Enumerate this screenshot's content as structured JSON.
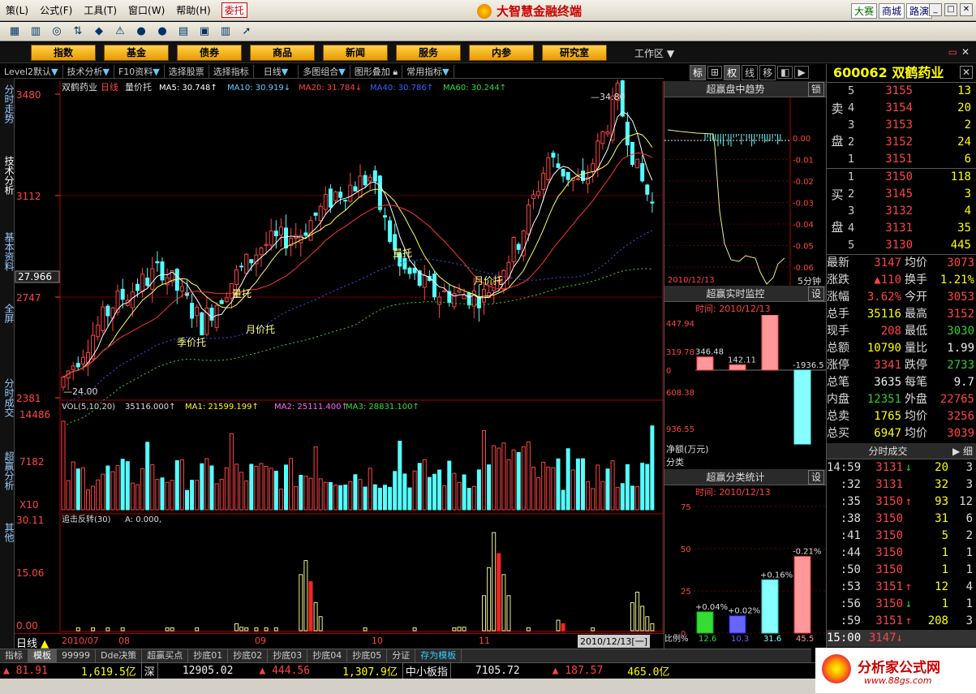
{
  "menu": [
    "策(L)",
    "公式(F)",
    "工具(T)",
    "窗口(W)",
    "帮助(H)"
  ],
  "menu_highlight": "委托",
  "app_title": "大智慧金融终端",
  "top_links": [
    "大赛",
    "商城",
    "路演"
  ],
  "nav_buttons": [
    "指数",
    "基金",
    "债券",
    "商品",
    "新闻",
    "服务",
    "内参",
    "研究室"
  ],
  "work_area": "工作区",
  "chart_toolbar": [
    "Level2默认",
    "技术分析",
    "F10资料",
    "选择股票",
    "选择指标",
    "日线",
    "多图组合",
    "图形叠加",
    "常用指标"
  ],
  "right_tabs": [
    "标",
    "权",
    "线",
    "移"
  ],
  "left_tabs": [
    "分时走势",
    "技术分析",
    "基本资料",
    "全屏",
    "分时成交",
    "超赢分析",
    "其他"
  ],
  "chart_header": {
    "name": "双鹤药业",
    "period": "日线",
    "indicator": "量价托",
    "ma5": "MA5: 30.748↑",
    "ma10": "MA10: 30.919↓",
    "ma20": "MA20: 31.784↓",
    "ma40": "MA40: 30.786↑",
    "ma60": "MA60: 30.244↑"
  },
  "vol_header": {
    "label": "VOL(5,10,20)",
    "vol": "35116.000↑",
    "ma1": "MA1: 21599.199↑",
    "ma2": "MA2: 25111.400↑",
    "ma3": "MA3: 28831.100↑"
  },
  "ind_header": {
    "label": "追击反转(30)",
    "a": "A: 0.000,"
  },
  "chart_data": {
    "type": "candlestick",
    "price_axis": {
      "ticks": [
        "3480",
        "3112",
        "2747",
        "2381"
      ],
      "range": [
        23.81,
        34.8
      ]
    },
    "cursor_value": "27.966",
    "high_label": "34.80",
    "low_label": "24.00",
    "vol_axis": {
      "ticks": [
        "14486",
        "7182",
        "X10"
      ],
      "range": [
        0,
        14486
      ]
    },
    "ind_axis": {
      "ticks": [
        "30.11",
        "15.06",
        "0.00"
      ],
      "range": [
        0,
        30.11
      ]
    },
    "date_axis": [
      "2010/07",
      "08",
      "09",
      "10",
      "11"
    ],
    "cursor_date": "2010/12/13[一]",
    "annotations": [
      "季价托",
      "量托",
      "月价托",
      "量托",
      "月价托",
      "月价托"
    ],
    "period_label": "日线"
  },
  "panel_trend": {
    "title": "超赢盘中趋势",
    "lock": "锁",
    "axis": [
      "0.00",
      "-0.01",
      "-0.02",
      "-0.03",
      "-0.04",
      "-0.05",
      "-0.06",
      "-0.07"
    ],
    "date": "2010/12/13",
    "period": "5分钟"
  },
  "panel_monitor": {
    "title": "超赢实时监控",
    "btn": "设",
    "time": "时间: 2010/12/13",
    "axis": [
      "447.94",
      "319.78",
      "0",
      "608.38",
      "936.55"
    ],
    "bars": [
      {
        "label": "散户",
        "value": "346.48",
        "v": 346.48
      },
      {
        "label": "中户",
        "value": "142.11",
        "v": 142.11
      },
      {
        "label": "大户",
        "value": "1447.94",
        "v": 1447.94
      },
      {
        "label": "超大",
        "value": "-1936.5",
        "v": -1936.5
      }
    ],
    "unit": "净额(万元)",
    "cat": "分类"
  },
  "panel_class": {
    "title": "超赢分类统计",
    "btn": "设",
    "time": "时间: 2010/12/13",
    "axis": [
      "75",
      "50",
      "25",
      "0"
    ],
    "bars": [
      {
        "label": "散户",
        "pct": "+0.04%",
        "value": "12.6",
        "v": 12.6
      },
      {
        "label": "中户",
        "pct": "+0.02%",
        "value": "10.3",
        "v": 10.3
      },
      {
        "label": "大户",
        "pct": "+0.16%",
        "value": "31.6",
        "v": 31.6
      },
      {
        "label": "超大",
        "pct": "-0.21%",
        "value": "45.5",
        "v": 45.5
      }
    ],
    "ratio": "比例%",
    "cat": "分类"
  },
  "quote": {
    "code": "600062",
    "name": "双鹤药业",
    "sell_label": [
      "卖",
      "盘"
    ],
    "buy_label": [
      "买",
      "盘"
    ],
    "asks": [
      {
        "lv": "5",
        "px": "3155",
        "vol": "13"
      },
      {
        "lv": "4",
        "px": "3154",
        "vol": "20"
      },
      {
        "lv": "3",
        "px": "3153",
        "vol": "2"
      },
      {
        "lv": "2",
        "px": "3152",
        "vol": "24"
      },
      {
        "lv": "1",
        "px": "3151",
        "vol": "6"
      }
    ],
    "bids": [
      {
        "lv": "1",
        "px": "3150",
        "vol": "118"
      },
      {
        "lv": "2",
        "px": "3145",
        "vol": "3"
      },
      {
        "lv": "3",
        "px": "3132",
        "vol": "4"
      },
      {
        "lv": "4",
        "px": "3131",
        "vol": "35"
      },
      {
        "lv": "5",
        "px": "3130",
        "vol": "445"
      }
    ],
    "stats": [
      {
        "l": "最新",
        "v": "3147",
        "c": "red",
        "l2": "均价",
        "v2": "3073",
        "c2": "red"
      },
      {
        "l": "涨跌",
        "v": "▲110",
        "c": "red",
        "l2": "换手",
        "v2": "1.21%",
        "c2": "yel"
      },
      {
        "l": "涨幅",
        "v": "3.62%",
        "c": "red",
        "l2": "今开",
        "v2": "3053",
        "c2": "red"
      },
      {
        "l": "总手",
        "v": "35116",
        "c": "yel",
        "l2": "最高",
        "v2": "3152",
        "c2": "red"
      },
      {
        "l": "现手",
        "v": "208",
        "c": "red",
        "l2": "最低",
        "v2": "3030",
        "c2": "grn"
      },
      {
        "l": "总额",
        "v": "10790",
        "c": "yel",
        "l2": "量比",
        "v2": "1.99",
        "c2": "wht"
      },
      {
        "l": "涨停",
        "v": "3341",
        "c": "red",
        "l2": "跌停",
        "v2": "2733",
        "c2": "grn"
      },
      {
        "l": "总笔",
        "v": "3635",
        "c": "wht",
        "l2": "每笔",
        "v2": "9.7",
        "c2": "wht"
      },
      {
        "l": "内盘",
        "v": "12351",
        "c": "grn",
        "l2": "外盘",
        "v2": "22765",
        "c2": "red"
      },
      {
        "l": "总卖",
        "v": "1765",
        "c": "yel",
        "l2": "均价",
        "v2": "3256",
        "c2": "red"
      },
      {
        "l": "总买",
        "v": "6947",
        "c": "yel",
        "l2": "均价",
        "v2": "3039",
        "c2": "red"
      }
    ],
    "ticks_title": "分时成交",
    "ticks_btn": "细",
    "ticks": [
      {
        "t": "14:59",
        "p": "3131",
        "a": "↓",
        "ac": "grn",
        "v": "20",
        "n": "3"
      },
      {
        "t": ":32",
        "p": "3131",
        "a": "",
        "ac": "",
        "v": "32",
        "n": "3"
      },
      {
        "t": ":35",
        "p": "3150",
        "a": "↑",
        "ac": "red",
        "v": "93",
        "n": "12"
      },
      {
        "t": ":38",
        "p": "3150",
        "a": "",
        "ac": "",
        "v": "31",
        "n": "6"
      },
      {
        "t": ":41",
        "p": "3150",
        "a": "",
        "ac": "",
        "v": "5",
        "n": "2"
      },
      {
        "t": ":44",
        "p": "3150",
        "a": "",
        "ac": "",
        "v": "1",
        "n": "1"
      },
      {
        "t": ":50",
        "p": "3150",
        "a": "",
        "ac": "",
        "v": "1",
        "n": "1"
      },
      {
        "t": ":53",
        "p": "3151",
        "a": "↑",
        "ac": "red",
        "v": "12",
        "n": "4"
      },
      {
        "t": ":56",
        "p": "3150",
        "a": "↓",
        "ac": "grn",
        "v": "1",
        "n": "1"
      },
      {
        "t": ":59",
        "p": "3151",
        "a": "↑",
        "ac": "red",
        "v": "208",
        "n": "3"
      }
    ],
    "last_tick": {
      "t": "15:00",
      "p": "3147↓"
    }
  },
  "bottom_tabs": [
    "指标",
    "模板",
    "99999",
    "Dde决策",
    "超赢买点",
    "抄底01",
    "抄底02",
    "抄底03",
    "抄底04",
    "抄底05",
    "分证",
    "存为模板"
  ],
  "ticker": [
    "▲ 81.91",
    "1,619.5亿",
    "深",
    "12905.02",
    "▲ 444.56",
    "1,307.9亿",
    "中小板指",
    "7105.72",
    "▲ 187.57",
    "465.0亿"
  ],
  "brand": {
    "name": "分析家公式网",
    "url": "www.88gs.com"
  },
  "colors": {
    "up": "#ff4444",
    "down": "#55ffff",
    "ma5": "#ffffff",
    "ma10": "#ffff55",
    "ma20": "#ff3333",
    "ma40": "#3355ff",
    "ma60": "#33dd33"
  }
}
